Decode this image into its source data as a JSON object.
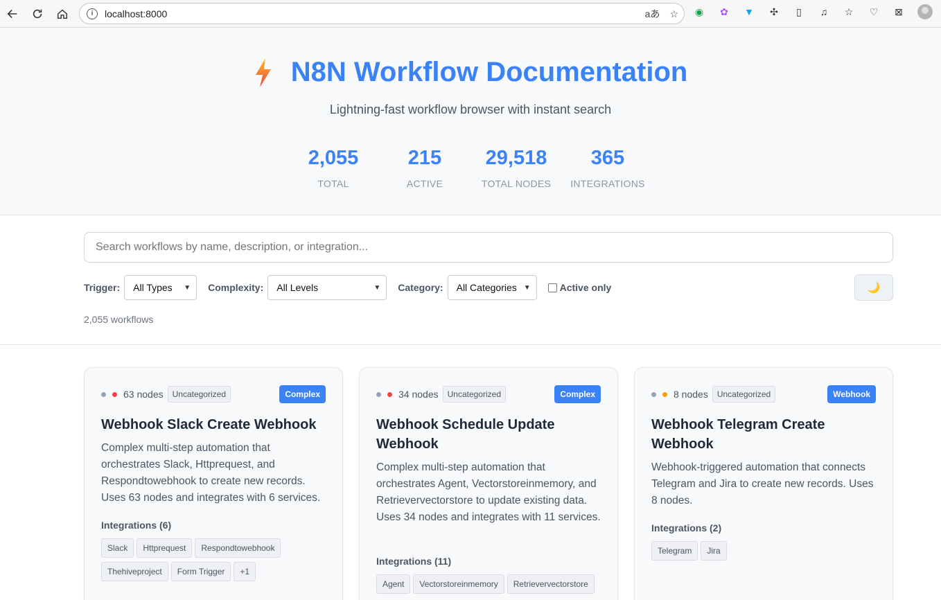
{
  "browser": {
    "url": "localhost:8000",
    "translate_icon": "translate-icon",
    "star_icon": "star-icon"
  },
  "header": {
    "title": "N8N Workflow Documentation",
    "subtitle": "Lightning-fast workflow browser with instant search",
    "stats": [
      {
        "value": "2,055",
        "label": "TOTAL"
      },
      {
        "value": "215",
        "label": "ACTIVE"
      },
      {
        "value": "29,518",
        "label": "TOTAL NODES"
      },
      {
        "value": "365",
        "label": "INTEGRATIONS"
      }
    ]
  },
  "search": {
    "placeholder": "Search workflows by name, description, or integration..."
  },
  "filters": {
    "trigger_label": "Trigger:",
    "trigger_value": "All Types",
    "complexity_label": "Complexity:",
    "complexity_value": "All Levels",
    "category_label": "Category:",
    "category_value": "All Categories",
    "active_only_label": "Active only"
  },
  "results": {
    "count_text": "2,055 workflows"
  },
  "colors": {
    "accent": "#3b82f6",
    "status_inactive": "#94a3b8",
    "complexity_high": "#ef4444",
    "complexity_medium": "#f59e0b"
  },
  "cards": [
    {
      "nodes": "63 nodes",
      "category": "Uncategorized",
      "badge": "Complex",
      "title": "Webhook Slack Create Webhook",
      "description": "Complex multi-step automation that orchestrates Slack, Httprequest, and Respondtowebhook to create new records. Uses 63 nodes and integrates with 6 services.",
      "integrations_heading": "Integrations (6)",
      "integrations": [
        "Slack",
        "Httprequest",
        "Respondtowebhook",
        "Thehiveproject",
        "Form Trigger",
        "+1"
      ]
    },
    {
      "nodes": "34 nodes",
      "category": "Uncategorized",
      "badge": "Complex",
      "title": "Webhook Schedule Update Webhook",
      "description": "Complex multi-step automation that orchestrates Agent, Vectorstoreinmemory, and Retrievervectorstore to update existing data. Uses 34 nodes and integrates with 11 services.",
      "integrations_heading": "Integrations (11)",
      "integrations": [
        "Agent",
        "Vectorstoreinmemory",
        "Retrievervectorstore"
      ]
    },
    {
      "nodes": "8 nodes",
      "category": "Uncategorized",
      "badge": "Webhook",
      "title": "Webhook Telegram Create Webhook",
      "description": "Webhook-triggered automation that connects Telegram and Jira to create new records. Uses 8 nodes.",
      "integrations_heading": "Integrations (2)",
      "integrations": [
        "Telegram",
        "Jira"
      ]
    }
  ]
}
